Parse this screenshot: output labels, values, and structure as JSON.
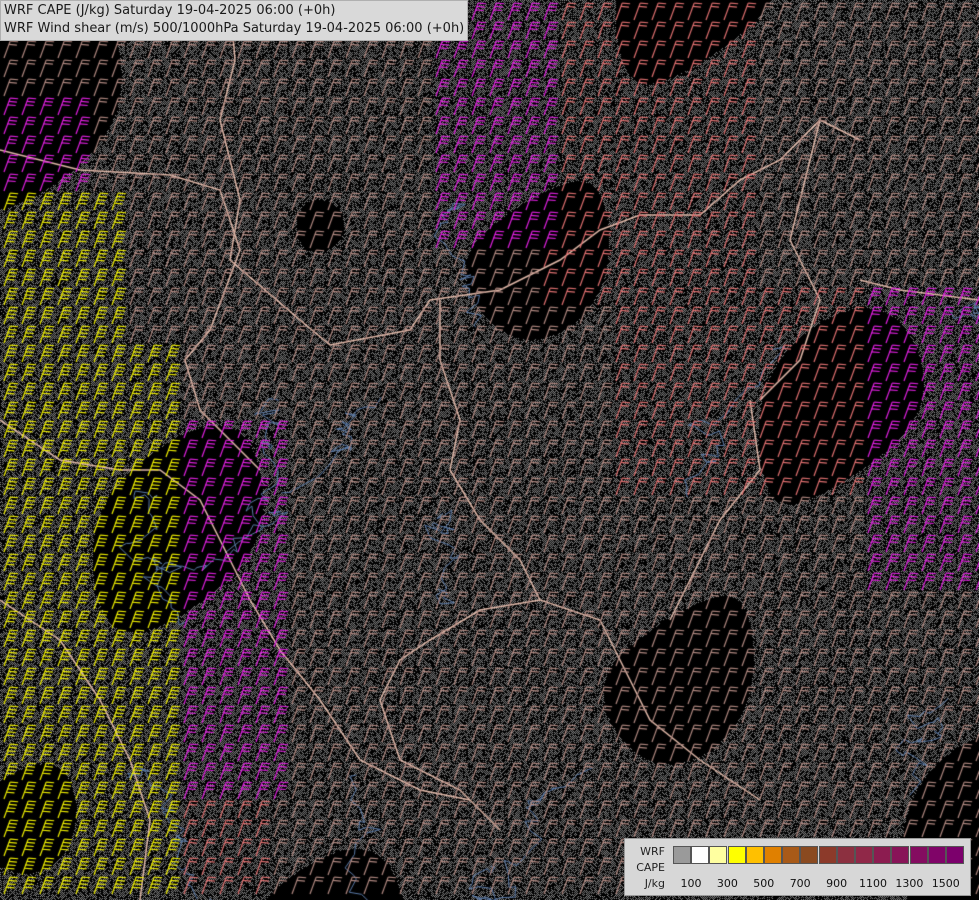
{
  "header": {
    "title_cape": "WRF CAPE (J/kg) Saturday 19-04-2025 06:00 (+0h)",
    "title_shear": "WRF Wind shear (m/s) 500/1000hPa Saturday 19-04-2025 06:00 (+0h)"
  },
  "legend": {
    "label_line1": "WRF",
    "label_line2": "CAPE",
    "label_line3": "J/kg",
    "colors": [
      "#9a9a9a",
      "#ffffff",
      "#ffffa0",
      "#ffff00",
      "#ffc000",
      "#e08000",
      "#a85a18",
      "#8a4a20",
      "#8c3a2a",
      "#8c3040",
      "#902848",
      "#8c1c50",
      "#881458",
      "#840c60",
      "#800468",
      "#7c006c"
    ],
    "ticks": [
      "100",
      "300",
      "500",
      "700",
      "900",
      "1100",
      "1300",
      "1500"
    ]
  },
  "map_style": {
    "background": "#000000",
    "speckle_color": "#7a7a7a",
    "border_color": "#e0b8a8",
    "river_color": "#5a7aa8",
    "barb_colors": {
      "low": "#b08880",
      "mid": "#e07070",
      "high": "#e020e0",
      "strong": "#f0f000"
    }
  }
}
